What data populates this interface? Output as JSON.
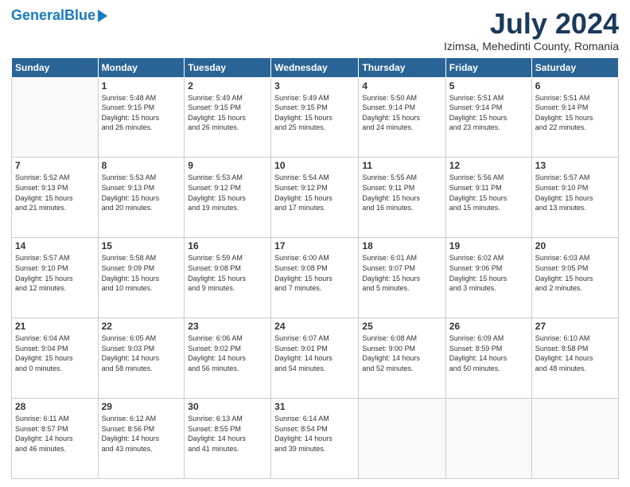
{
  "logo": {
    "part1": "General",
    "part2": "Blue"
  },
  "header": {
    "month": "July 2024",
    "location": "Izimsa, Mehedinti County, Romania"
  },
  "weekdays": [
    "Sunday",
    "Monday",
    "Tuesday",
    "Wednesday",
    "Thursday",
    "Friday",
    "Saturday"
  ],
  "weeks": [
    [
      {
        "day": "",
        "info": ""
      },
      {
        "day": "1",
        "info": "Sunrise: 5:48 AM\nSunset: 9:15 PM\nDaylight: 15 hours\nand 26 minutes."
      },
      {
        "day": "2",
        "info": "Sunrise: 5:49 AM\nSunset: 9:15 PM\nDaylight: 15 hours\nand 26 minutes."
      },
      {
        "day": "3",
        "info": "Sunrise: 5:49 AM\nSunset: 9:15 PM\nDaylight: 15 hours\nand 25 minutes."
      },
      {
        "day": "4",
        "info": "Sunrise: 5:50 AM\nSunset: 9:14 PM\nDaylight: 15 hours\nand 24 minutes."
      },
      {
        "day": "5",
        "info": "Sunrise: 5:51 AM\nSunset: 9:14 PM\nDaylight: 15 hours\nand 23 minutes."
      },
      {
        "day": "6",
        "info": "Sunrise: 5:51 AM\nSunset: 9:14 PM\nDaylight: 15 hours\nand 22 minutes."
      }
    ],
    [
      {
        "day": "7",
        "info": "Sunrise: 5:52 AM\nSunset: 9:13 PM\nDaylight: 15 hours\nand 21 minutes."
      },
      {
        "day": "8",
        "info": "Sunrise: 5:53 AM\nSunset: 9:13 PM\nDaylight: 15 hours\nand 20 minutes."
      },
      {
        "day": "9",
        "info": "Sunrise: 5:53 AM\nSunset: 9:12 PM\nDaylight: 15 hours\nand 19 minutes."
      },
      {
        "day": "10",
        "info": "Sunrise: 5:54 AM\nSunset: 9:12 PM\nDaylight: 15 hours\nand 17 minutes."
      },
      {
        "day": "11",
        "info": "Sunrise: 5:55 AM\nSunset: 9:11 PM\nDaylight: 15 hours\nand 16 minutes."
      },
      {
        "day": "12",
        "info": "Sunrise: 5:56 AM\nSunset: 9:11 PM\nDaylight: 15 hours\nand 15 minutes."
      },
      {
        "day": "13",
        "info": "Sunrise: 5:57 AM\nSunset: 9:10 PM\nDaylight: 15 hours\nand 13 minutes."
      }
    ],
    [
      {
        "day": "14",
        "info": "Sunrise: 5:57 AM\nSunset: 9:10 PM\nDaylight: 15 hours\nand 12 minutes."
      },
      {
        "day": "15",
        "info": "Sunrise: 5:58 AM\nSunset: 9:09 PM\nDaylight: 15 hours\nand 10 minutes."
      },
      {
        "day": "16",
        "info": "Sunrise: 5:59 AM\nSunset: 9:08 PM\nDaylight: 15 hours\nand 9 minutes."
      },
      {
        "day": "17",
        "info": "Sunrise: 6:00 AM\nSunset: 9:08 PM\nDaylight: 15 hours\nand 7 minutes."
      },
      {
        "day": "18",
        "info": "Sunrise: 6:01 AM\nSunset: 9:07 PM\nDaylight: 15 hours\nand 5 minutes."
      },
      {
        "day": "19",
        "info": "Sunrise: 6:02 AM\nSunset: 9:06 PM\nDaylight: 15 hours\nand 3 minutes."
      },
      {
        "day": "20",
        "info": "Sunrise: 6:03 AM\nSunset: 9:05 PM\nDaylight: 15 hours\nand 2 minutes."
      }
    ],
    [
      {
        "day": "21",
        "info": "Sunrise: 6:04 AM\nSunset: 9:04 PM\nDaylight: 15 hours\nand 0 minutes."
      },
      {
        "day": "22",
        "info": "Sunrise: 6:05 AM\nSunset: 9:03 PM\nDaylight: 14 hours\nand 58 minutes."
      },
      {
        "day": "23",
        "info": "Sunrise: 6:06 AM\nSunset: 9:02 PM\nDaylight: 14 hours\nand 56 minutes."
      },
      {
        "day": "24",
        "info": "Sunrise: 6:07 AM\nSunset: 9:01 PM\nDaylight: 14 hours\nand 54 minutes."
      },
      {
        "day": "25",
        "info": "Sunrise: 6:08 AM\nSunset: 9:00 PM\nDaylight: 14 hours\nand 52 minutes."
      },
      {
        "day": "26",
        "info": "Sunrise: 6:09 AM\nSunset: 8:59 PM\nDaylight: 14 hours\nand 50 minutes."
      },
      {
        "day": "27",
        "info": "Sunrise: 6:10 AM\nSunset: 8:58 PM\nDaylight: 14 hours\nand 48 minutes."
      }
    ],
    [
      {
        "day": "28",
        "info": "Sunrise: 6:11 AM\nSunset: 8:57 PM\nDaylight: 14 hours\nand 46 minutes."
      },
      {
        "day": "29",
        "info": "Sunrise: 6:12 AM\nSunset: 8:56 PM\nDaylight: 14 hours\nand 43 minutes."
      },
      {
        "day": "30",
        "info": "Sunrise: 6:13 AM\nSunset: 8:55 PM\nDaylight: 14 hours\nand 41 minutes."
      },
      {
        "day": "31",
        "info": "Sunrise: 6:14 AM\nSunset: 8:54 PM\nDaylight: 14 hours\nand 39 minutes."
      },
      {
        "day": "",
        "info": ""
      },
      {
        "day": "",
        "info": ""
      },
      {
        "day": "",
        "info": ""
      }
    ]
  ]
}
